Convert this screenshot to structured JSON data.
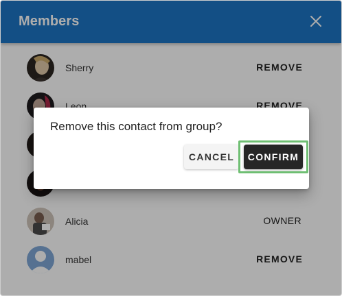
{
  "header": {
    "title": "Members",
    "close_icon": "close-icon"
  },
  "members": [
    {
      "name": "Sherry",
      "action": "REMOVE",
      "avatar": "avatar-photo"
    },
    {
      "name": "Leon",
      "action": "REMOVE",
      "avatar": "avatar-photo"
    },
    {
      "name": "",
      "action": "",
      "avatar": "avatar-photo"
    },
    {
      "name": "",
      "action": "",
      "avatar": "avatar-photo"
    },
    {
      "name": "Alicia",
      "action": "OWNER",
      "avatar": "avatar-photo"
    },
    {
      "name": "mabel",
      "action": "REMOVE",
      "avatar": "avatar-default-user-icon"
    }
  ],
  "dialog": {
    "message": "Remove this contact from group?",
    "cancel_label": "CANCEL",
    "confirm_label": "CONFIRM"
  },
  "colors": {
    "header": "#1d75c4",
    "confirm_button": "#262626",
    "highlight": "#6fbf73"
  }
}
